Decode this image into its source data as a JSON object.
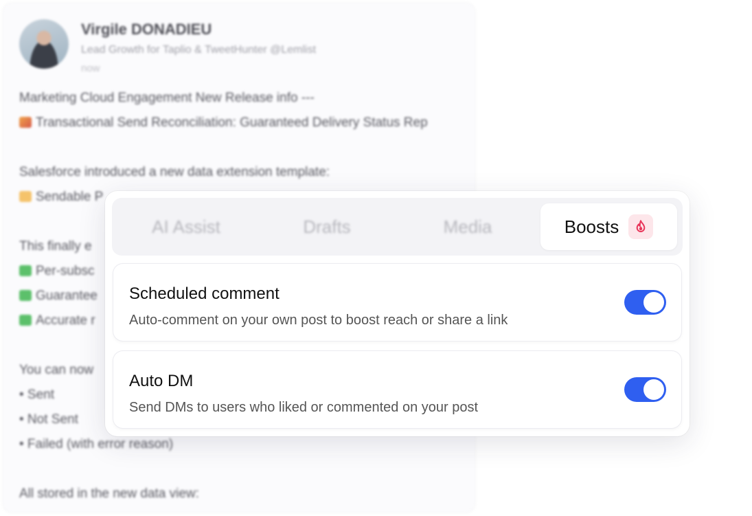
{
  "post": {
    "author_name": "Virgile DONADIEU",
    "author_bio": "Lead Growth for Taplio & TweetHunter @Lemlist",
    "time": "now",
    "lines": {
      "l1": "Marketing Cloud Engagement New Release info ---",
      "l2": "Transactional Send Reconciliation: Guaranteed Delivery Status Rep",
      "l3": "Salesforce introduced a new data extension template:",
      "l4": "Sendable P",
      "l5": "This finally e",
      "l6": "Per-subsc",
      "l7": "Guarantee",
      "l8": "Accurate r",
      "l9": "You can now",
      "l10": "• Sent",
      "l11": "• Not Sent",
      "l12": "• Failed (with error reason)",
      "l13": "All stored in the new data view:"
    }
  },
  "tabs": {
    "ai_assist": "AI Assist",
    "drafts": "Drafts",
    "media": "Media",
    "boosts": "Boosts"
  },
  "options": {
    "scheduled": {
      "title": "Scheduled comment",
      "desc": "Auto-comment on your own post to boost reach or share a link",
      "enabled": true
    },
    "auto_dm": {
      "title": "Auto DM",
      "desc": "Send DMs to users who liked or commented on your post",
      "enabled": true
    }
  },
  "colors": {
    "toggle_on": "#2f5ff0",
    "flame": "#e8365a",
    "flame_bg": "#fde6ea"
  },
  "icons": {
    "boost": "flame-icon",
    "avatar": "profile-photo"
  }
}
